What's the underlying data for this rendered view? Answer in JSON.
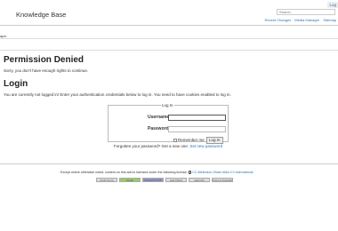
{
  "header": {
    "site_title": "Knowledge Base",
    "login_link": "Log",
    "search_placeholder": "Search",
    "nav": [
      "Recent Changes",
      "Media Manager",
      "Sitemap"
    ]
  },
  "breadcrumb": "ape:",
  "main": {
    "title": "Permission Denied",
    "message": "Sorry, you don't have enough rights to continue.",
    "login_heading": "Login",
    "intro": "You are currently not logged in! Enter your authentication credentials below to log in. You need to have cookies enabled to log in."
  },
  "login_form": {
    "legend": "Log In",
    "username_label": "Username",
    "username_value": "",
    "password_label": "Password",
    "password_value": "",
    "remember_label": "Remember me",
    "submit_label": "Log In"
  },
  "forgot": {
    "text": "Forgotten your password? Get a new one:",
    "link": "Set new password"
  },
  "footer": {
    "license_text": "Except where otherwise noted, content on this wiki is licensed under the following license:",
    "license_link": "CC Attribution-Share Alike 4.0 International",
    "badges": [
      "CC BY-SA 4.0",
      "Donate",
      "Powered by PHP",
      "Valid HTML5",
      "Valid CSS",
      "Driven by DokuWiki"
    ]
  }
}
